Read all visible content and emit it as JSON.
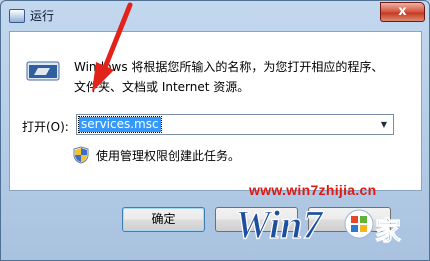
{
  "window": {
    "title": "运行",
    "close_glyph": "x"
  },
  "dialog": {
    "description_lines": [
      "Windows 将根据您所输入的名称，为您打开相应的程序、",
      "文件夹、文档或 Internet 资源。"
    ],
    "open_label": "打开(O):",
    "open_value": "services.msc",
    "admin_note": "使用管理权限创建此任务。"
  },
  "buttons": {
    "ok": "确定",
    "cancel": "",
    "browse": ""
  },
  "watermark": {
    "url": "www.win7zhijia.cn",
    "logo_text": "Win7之家"
  },
  "colors": {
    "accent": "#3399ff",
    "arrow": "#e2231a",
    "watermark": "#e0190f"
  },
  "icons": [
    "run-icon",
    "uac-shield-icon",
    "chevron-down-icon",
    "close-icon"
  ]
}
